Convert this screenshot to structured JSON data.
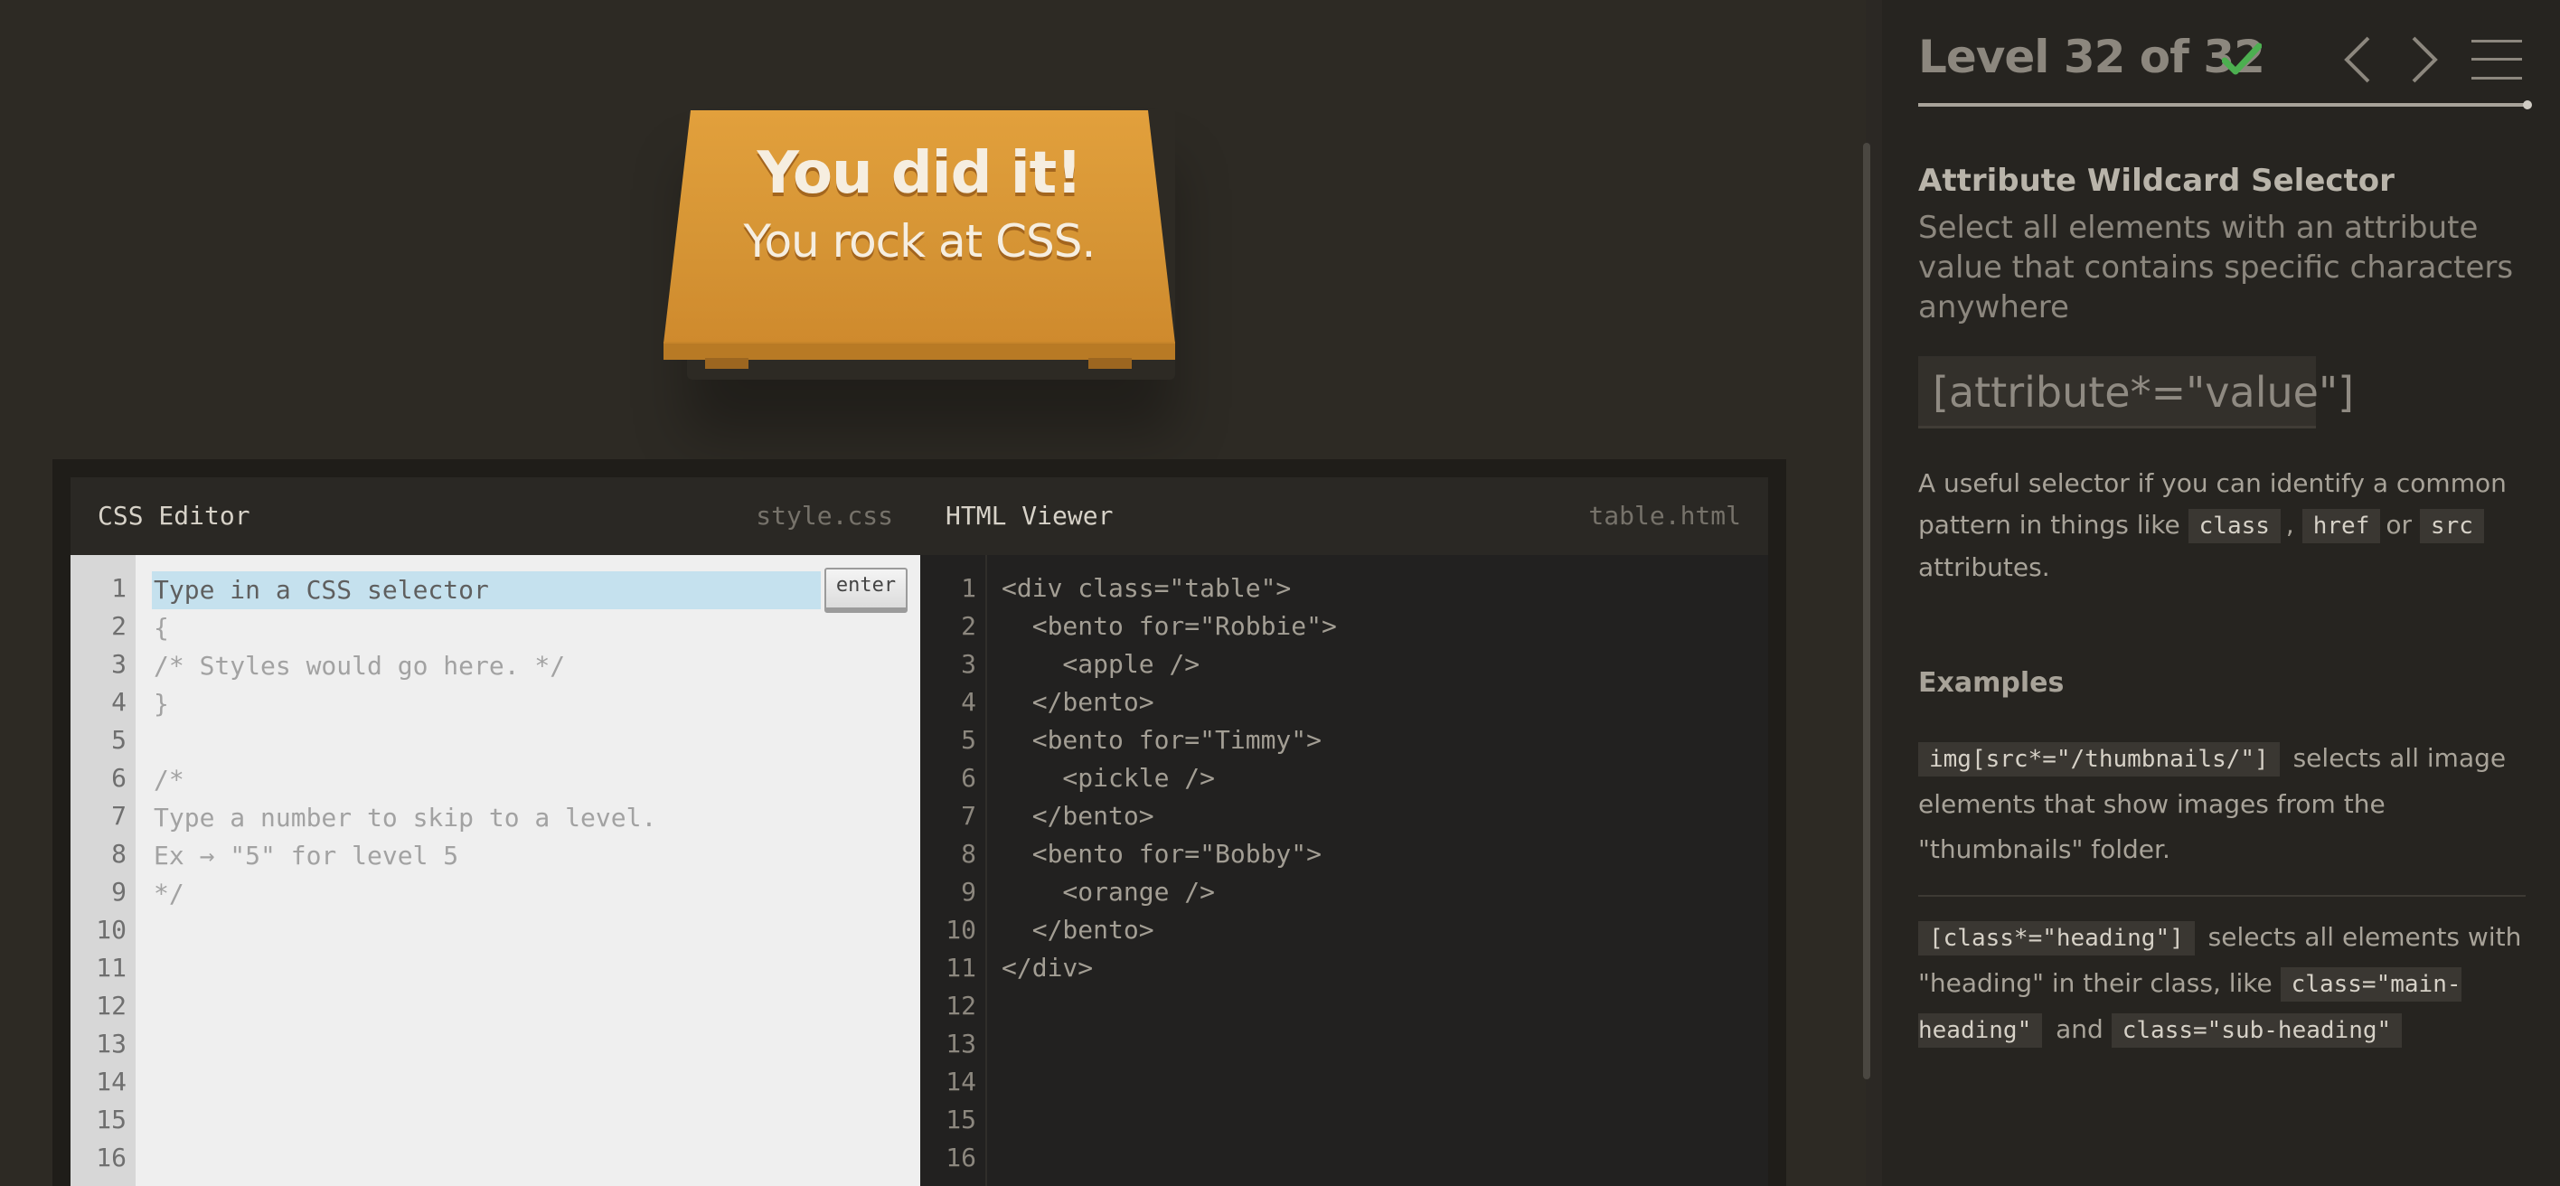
{
  "game": {
    "win_title": "You did it!",
    "win_subtitle": "You rock at CSS."
  },
  "css_editor": {
    "title": "CSS Editor",
    "filename": "style.css",
    "input_placeholder": "Type in a CSS selector",
    "enter_label": "enter",
    "line_numbers": [
      "1",
      "2",
      "3",
      "4",
      "5",
      "6",
      "7",
      "8",
      "9",
      "10",
      "11",
      "12",
      "13",
      "14",
      "15",
      "16"
    ],
    "code_lines": [
      "{",
      "/* Styles would go here. */",
      "}",
      "",
      "/*",
      "Type a number to skip to a level.",
      "Ex → \"5\" for level 5",
      "*/"
    ]
  },
  "html_viewer": {
    "title": "HTML Viewer",
    "filename": "table.html",
    "line_numbers": [
      "1",
      "2",
      "3",
      "4",
      "5",
      "6",
      "7",
      "8",
      "9",
      "10",
      "11",
      "12",
      "13",
      "14",
      "15",
      "16"
    ],
    "code_lines": [
      "<div class=\"table\">",
      "  <bento for=\"Robbie\">",
      "    <apple />",
      "  </bento>",
      "  <bento for=\"Timmy\">",
      "    <pickle />",
      "  </bento>",
      "  <bento for=\"Bobby\">",
      "    <orange />",
      "  </bento>",
      "</div>"
    ]
  },
  "sidebar": {
    "level_title": "Level 32 of 32",
    "progress": 1.0,
    "selector_name": "Attribute Wildcard Selector",
    "selector_description": "Select all elements with an attribute value that contains specific characters anywhere",
    "syntax": "[attribute*=\"value\"]",
    "hint_text_1": "A useful selector if you can identify a common pattern in things like",
    "hint_code_class": "class",
    "hint_sep": ",",
    "hint_code_href": "href",
    "hint_or": "or",
    "hint_code_src": "src",
    "hint_text_2": "attributes.",
    "examples_heading": "Examples",
    "example_1_code": "img[src*=\"/thumbnails/\"]",
    "example_1_text": "selects all image elements that show images from the \"thumbnails\" folder.",
    "example_2_code": "[class*=\"heading\"]",
    "example_2_text_1": "selects all elements with \"heading\" in their class, like",
    "example_2_code_a": "class=\"main-heading\"",
    "example_2_and": "and",
    "example_2_code_b": "class=\"sub-heading\""
  },
  "colors": {
    "background": "#2d2a24",
    "board": "#d69535",
    "check": "#4caf50",
    "sidebar": "#262420"
  },
  "icons": [
    "check-icon",
    "chevron-left-icon",
    "chevron-right-icon",
    "menu-icon"
  ]
}
